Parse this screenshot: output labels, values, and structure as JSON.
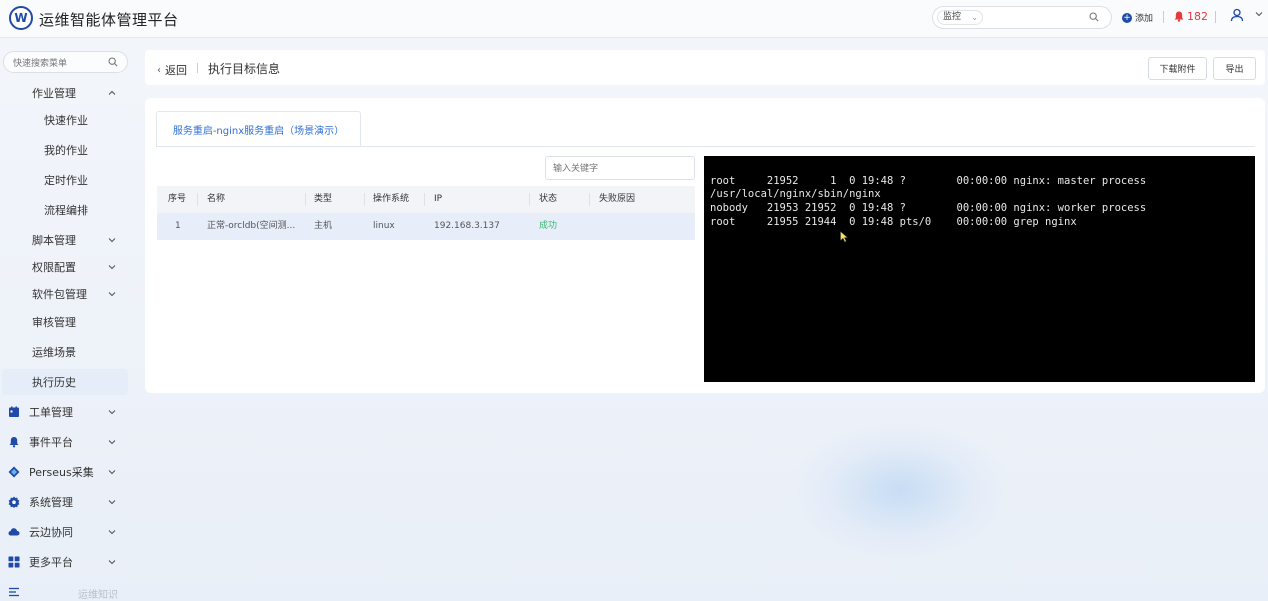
{
  "app": {
    "logo_text": "W",
    "title": "运维智能体管理平台"
  },
  "header": {
    "search_select": "监控",
    "search_placeholder": "",
    "add_label": "添加",
    "notification_count": "182"
  },
  "sidebar": {
    "search_placeholder": "快速搜索菜单",
    "items": [
      {
        "label": "作业管理",
        "level": 1,
        "expanded": true
      },
      {
        "label": "快速作业",
        "level": 2
      },
      {
        "label": "我的作业",
        "level": 2
      },
      {
        "label": "定时作业",
        "level": 2
      },
      {
        "label": "流程编排",
        "level": 2
      },
      {
        "label": "脚本管理",
        "level": 1
      },
      {
        "label": "权限配置",
        "level": 1
      },
      {
        "label": "软件包管理",
        "level": 1
      },
      {
        "label": "审核管理",
        "level": 1
      },
      {
        "label": "运维场景",
        "level": 1
      },
      {
        "label": "执行历史",
        "level": 1,
        "active": true
      },
      {
        "label": "工单管理",
        "icon": "ticket-icon",
        "level": 0
      },
      {
        "label": "事件平台",
        "icon": "bell-icon",
        "level": 0
      },
      {
        "label": "Perseus采集",
        "icon": "diamond-icon",
        "level": 0
      },
      {
        "label": "系统管理",
        "icon": "gear-icon",
        "level": 0
      },
      {
        "label": "云边协同",
        "icon": "cloud-icon",
        "level": 0
      },
      {
        "label": "更多平台",
        "icon": "grid-icon",
        "level": 0
      }
    ],
    "footer_text": "运维知识"
  },
  "topbar": {
    "back_label": "返回",
    "page_title": "执行目标信息",
    "download_label": "下载附件",
    "export_label": "导出"
  },
  "panel": {
    "tab_label": "服务重启-nginx服务重启（场景演示）",
    "keyword_placeholder": "输入关键字",
    "columns": [
      "序号",
      "名称",
      "类型",
      "操作系统",
      "IP",
      "状态",
      "失败原因"
    ],
    "rows": [
      [
        "1",
        "正常-orcldb(空间测...",
        "主机",
        "linux",
        "192.168.3.137",
        "成功",
        ""
      ]
    ],
    "terminal_lines": [
      "root     21952     1  0 19:48 ?        00:00:00 nginx: master process",
      "/usr/local/nginx/sbin/nginx",
      "nobody   21953 21952  0 19:48 ?        00:00:00 nginx: worker process",
      "root     21955 21944  0 19:48 pts/0    00:00:00 grep nginx"
    ]
  },
  "colors": {
    "brand": "#1f4aa8",
    "tab_active": "#2f6fd6",
    "success": "#3cb371",
    "alert": "#e03c3c",
    "terminal_bg": "#000000"
  }
}
